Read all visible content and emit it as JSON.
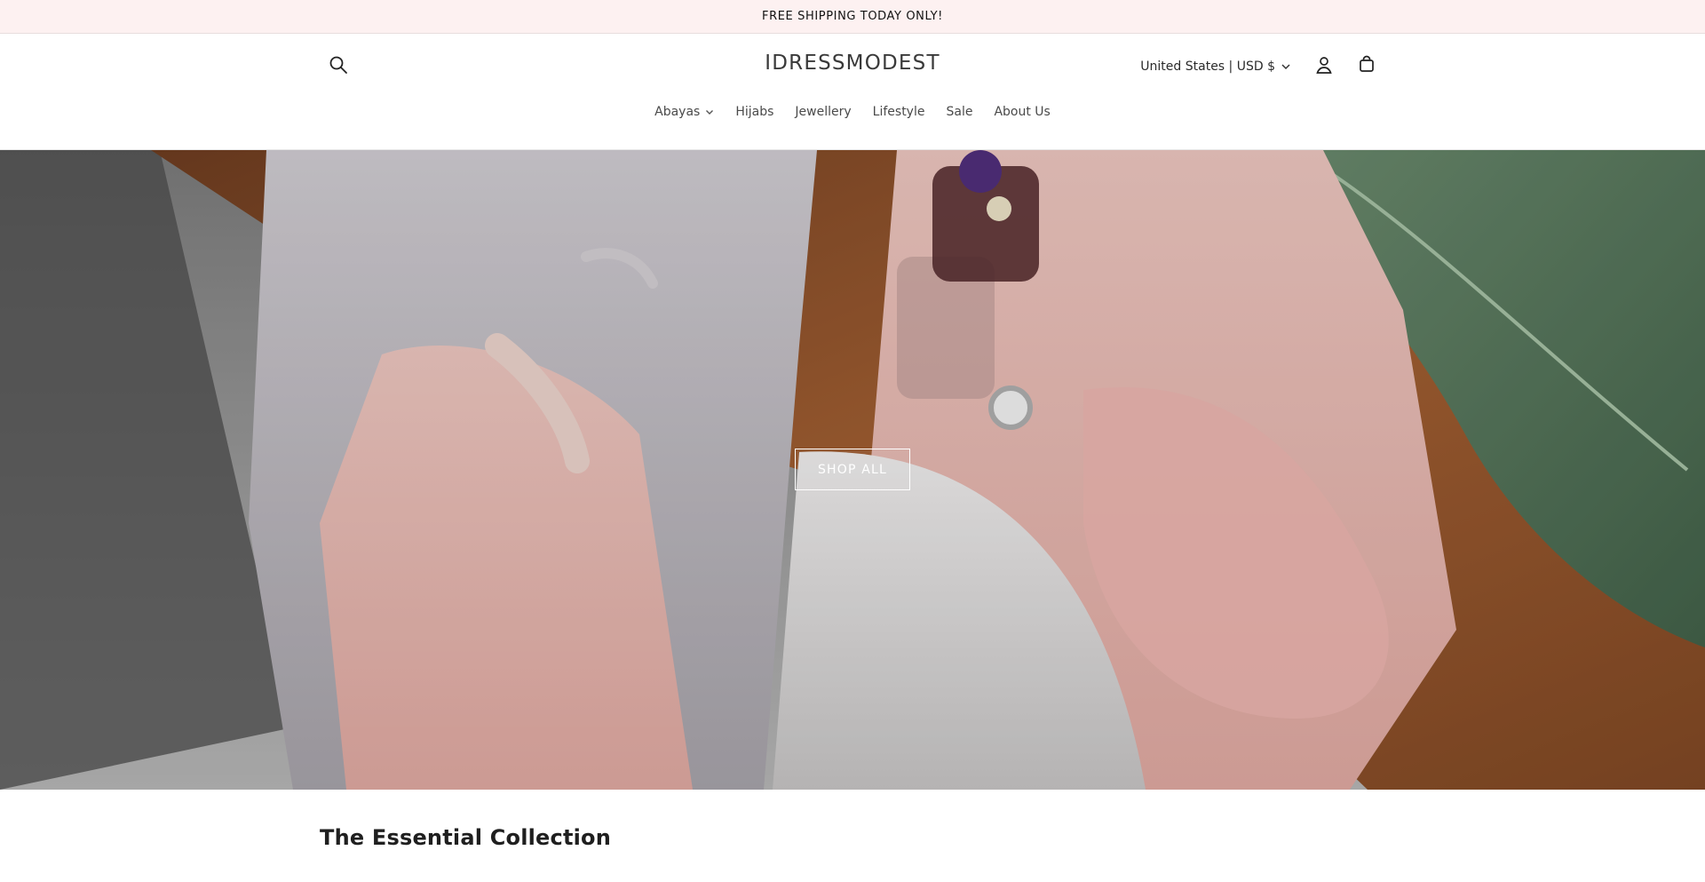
{
  "announcement": {
    "text": "FREE SHIPPING TODAY ONLY!"
  },
  "header": {
    "brand": "IDRESSMODEST",
    "country_selector": "United States | USD $",
    "icons": [
      "search-icon",
      "account-icon",
      "cart-icon",
      "chevron-down-icon"
    ]
  },
  "nav": {
    "items": [
      {
        "label": "Abayas",
        "has_dropdown": true
      },
      {
        "label": "Hijabs"
      },
      {
        "label": "Jewellery"
      },
      {
        "label": "Lifestyle"
      },
      {
        "label": "Sale"
      },
      {
        "label": "About Us"
      }
    ]
  },
  "hero": {
    "button_label": "SHOP ALL"
  },
  "collection": {
    "title": "The Essential Collection"
  },
  "colors": {
    "announcement_bg": "#fdf1f1",
    "text": "#121212",
    "hero_button_border": "#ffffff"
  }
}
